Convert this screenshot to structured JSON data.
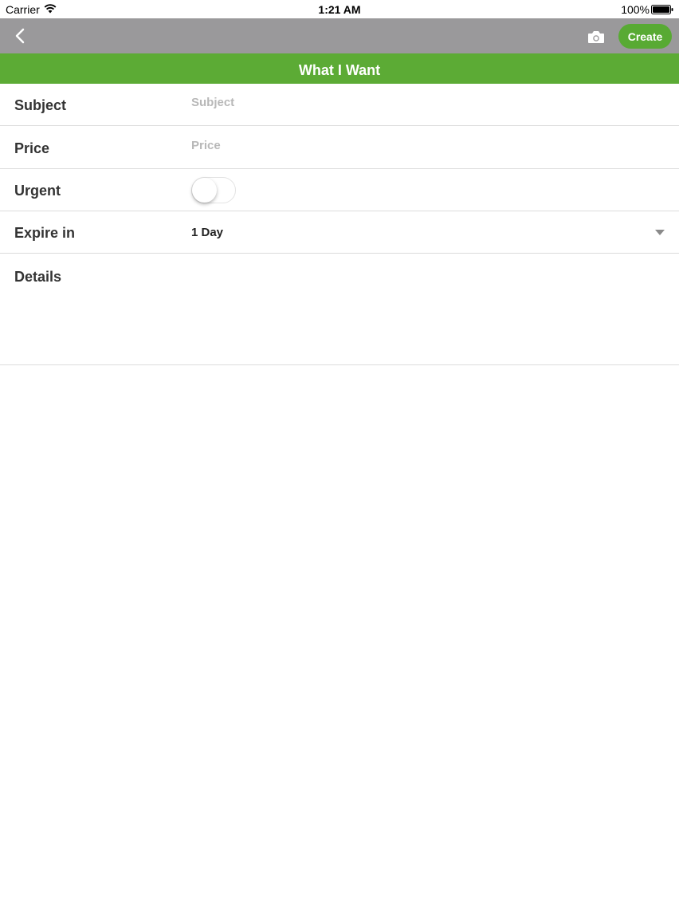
{
  "status_bar": {
    "carrier": "Carrier",
    "time": "1:21 AM",
    "battery": "100%"
  },
  "nav": {
    "back_icon": "chevron-left-icon",
    "camera_icon": "camera-icon",
    "create_label": "Create"
  },
  "section": {
    "title": "What I Want"
  },
  "form": {
    "subject": {
      "label": "Subject",
      "placeholder": "Subject",
      "value": ""
    },
    "price": {
      "label": "Price",
      "placeholder": "Price",
      "value": ""
    },
    "urgent": {
      "label": "Urgent",
      "on": false
    },
    "expire": {
      "label": "Expire in",
      "value": "1 Day"
    },
    "details": {
      "label": "Details",
      "value": ""
    }
  },
  "colors": {
    "nav_bg": "#9a999b",
    "accent": "#5cab35",
    "create_bg": "#58aa33"
  }
}
